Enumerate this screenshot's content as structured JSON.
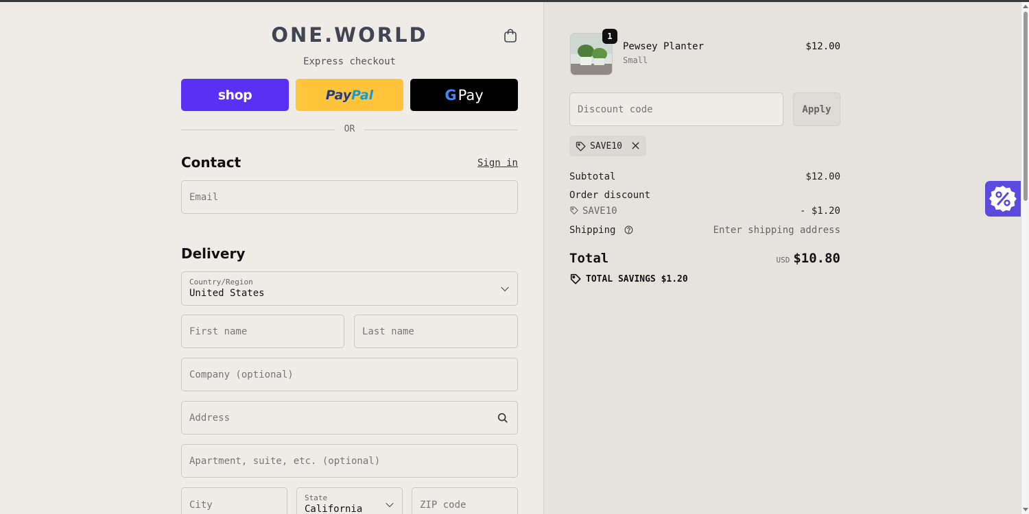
{
  "brand": {
    "logo": "ONE.WORLD"
  },
  "express": {
    "label": "Express checkout",
    "shop_label": "shop",
    "paypal_label_1": "Pay",
    "paypal_label_2": "Pal",
    "gpay_g": "G",
    "gpay_label": "Pay",
    "or_label": "OR"
  },
  "contact": {
    "title": "Contact",
    "signin_label": "Sign in",
    "email_placeholder": "Email"
  },
  "delivery": {
    "title": "Delivery",
    "country_label": "Country/Region",
    "country_value": "United States",
    "first_name_placeholder": "First name",
    "last_name_placeholder": "Last name",
    "company_placeholder": "Company (optional)",
    "address_placeholder": "Address",
    "apartment_placeholder": "Apartment, suite, etc. (optional)",
    "city_placeholder": "City",
    "state_label": "State",
    "state_value": "California",
    "zip_placeholder": "ZIP code"
  },
  "cart": {
    "item": {
      "name": "Pewsey Planter",
      "variant": "Small",
      "price": "$12.00",
      "quantity": "1"
    },
    "discount_placeholder": "Discount code",
    "apply_label": "Apply",
    "applied_code": "SAVE10"
  },
  "summary": {
    "subtotal_label": "Subtotal",
    "subtotal_value": "$12.00",
    "order_discount_label": "Order discount",
    "discount_code": "SAVE10",
    "discount_value": "- $1.20",
    "shipping_label": "Shipping",
    "shipping_value": "Enter shipping address",
    "total_label": "Total",
    "total_currency": "USD",
    "total_value": "$10.80",
    "savings_label": "TOTAL SAVINGS $1.20"
  },
  "colors": {
    "shop_pay": "#5a31f4",
    "paypal": "#ffc439",
    "gpay": "#000000",
    "promo_widget": "#5a4ae0"
  },
  "icons": {
    "cart": "shopping-bag-icon",
    "search": "search-icon",
    "tag": "tag-icon",
    "close": "close-icon",
    "help": "help-circle-icon",
    "promo": "percent-badge-icon"
  }
}
